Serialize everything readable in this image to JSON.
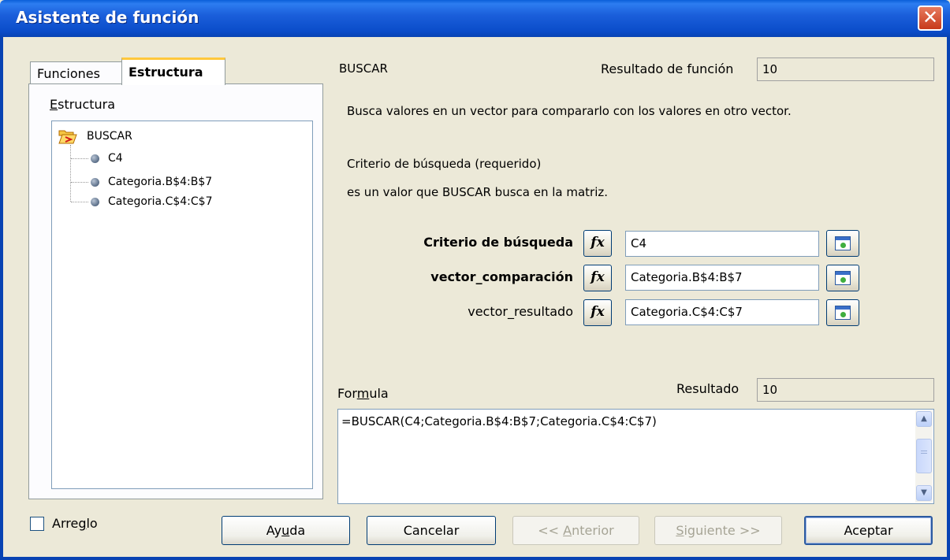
{
  "window": {
    "title": "Asistente de función",
    "close_glyph": "✕"
  },
  "tabs": [
    {
      "label": "Funciones",
      "active": false
    },
    {
      "label": "Estructura",
      "active": true
    }
  ],
  "structure": {
    "label": "Estructura",
    "root": {
      "label": "BUSCAR",
      "icon": "open-folder-icon"
    },
    "items": [
      {
        "label": "C4"
      },
      {
        "label": "Categoria.B$4:B$7"
      },
      {
        "label": "Categoria.C$4:C$7"
      }
    ]
  },
  "function": {
    "name": "BUSCAR",
    "result_label": "Resultado de función",
    "result_value": "10",
    "description": "Busca valores en un vector para compararlo con los valores en otro vector.",
    "param_title": "Criterio de búsqueda (requerido)",
    "param_description": "es un valor que BUSCAR busca en la matriz."
  },
  "arguments": [
    {
      "label": "Criterio de búsqueda",
      "value": "C4",
      "bold": true
    },
    {
      "label": "vector_comparación",
      "value": "Categoria.B$4:B$7",
      "bold": true
    },
    {
      "label": "vector_resultado",
      "value": "Categoria.C$4:C$7",
      "bold": false
    }
  ],
  "fx_label": "fx",
  "formula": {
    "label": "Formula",
    "result_label": "Resultado",
    "result_value": "10",
    "text": "=BUSCAR(C4;Categoria.B$4:B$7;Categoria.C$4:C$7)"
  },
  "footer": {
    "array_checkbox_label": "Arreglo",
    "array_checked": false,
    "buttons": {
      "help": "Ayuda",
      "cancel": "Cancelar",
      "back": "<< Anterior",
      "next": "Siguiente >>",
      "ok": "Aceptar"
    }
  },
  "colors": {
    "titlebar": "#0a4cc9",
    "dialog_bg": "#ece9d8",
    "tab_accent": "#ffc83c",
    "close_button": "#c7391a"
  }
}
